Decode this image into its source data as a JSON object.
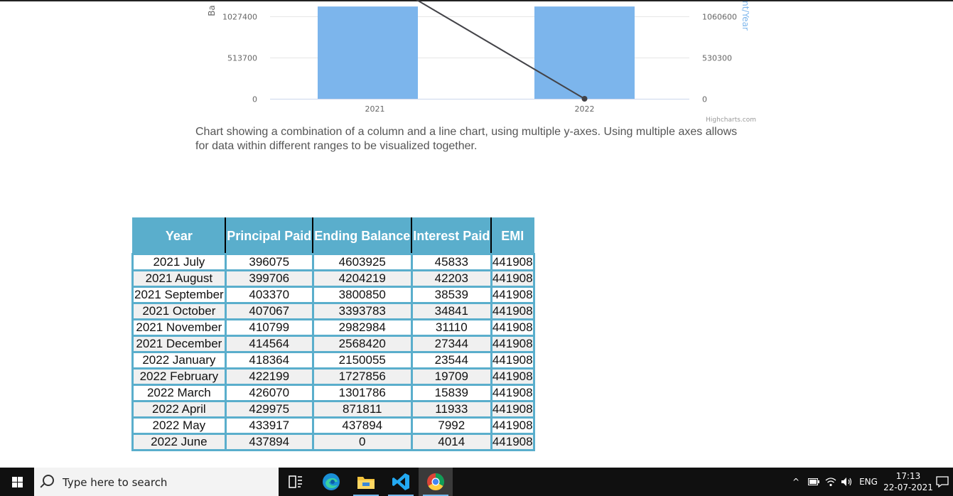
{
  "chart_data": {
    "type": "bar",
    "categories": [
      "2021",
      "2022"
    ],
    "series": [
      {
        "type": "column",
        "values": [
          1150000,
          1150000
        ],
        "axis": "left"
      },
      {
        "type": "line",
        "values": [
          1590000,
          0
        ],
        "axis": "right"
      }
    ],
    "left_axis": {
      "title_fragment": "Ba",
      "ticks": [
        "1027400",
        "513700",
        "0"
      ],
      "tick_values": [
        1027400,
        513700,
        0
      ],
      "range": [
        0,
        1150000
      ]
    },
    "right_axis": {
      "title_fragment": "nt/Year",
      "ticks": [
        "1060600",
        "530300",
        "0"
      ],
      "tick_values": [
        1060600,
        530300,
        0
      ],
      "range": [
        0,
        1187000
      ]
    },
    "credits": "Highcharts.com",
    "colors": {
      "column": "#7cb5ec",
      "line": "#434348",
      "right_title": "#7cb5ec",
      "grid": "#e6e6e6"
    }
  },
  "caption": "Chart showing a combination of a column and a line chart, using multiple y-axes. Using multiple axes allows for data within different ranges to be visualized together.",
  "table": {
    "headers": {
      "year": "Year",
      "principal": "Principal Paid",
      "ending": "Ending Balance",
      "interest": "Interest Paid",
      "emi": "EMI"
    },
    "rows": [
      [
        "2021 July",
        "396075",
        "4603925",
        "45833",
        "441908"
      ],
      [
        "2021 August",
        "399706",
        "4204219",
        "42203",
        "441908"
      ],
      [
        "2021 September",
        "403370",
        "3800850",
        "38539",
        "441908"
      ],
      [
        "2021 October",
        "407067",
        "3393783",
        "34841",
        "441908"
      ],
      [
        "2021 November",
        "410799",
        "2982984",
        "31110",
        "441908"
      ],
      [
        "2021 December",
        "414564",
        "2568420",
        "27344",
        "441908"
      ],
      [
        "2022 January",
        "418364",
        "2150055",
        "23544",
        "441908"
      ],
      [
        "2022 February",
        "422199",
        "1727856",
        "19709",
        "441908"
      ],
      [
        "2022 March",
        "426070",
        "1301786",
        "15839",
        "441908"
      ],
      [
        "2022 April",
        "429975",
        "871811",
        "11933",
        "441908"
      ],
      [
        "2022 May",
        "433917",
        "437894",
        "7992",
        "441908"
      ],
      [
        "2022 June",
        "437894",
        "0",
        "4014",
        "441908"
      ]
    ]
  },
  "taskbar": {
    "search_placeholder": "Type here to search",
    "apps": [
      "task-view",
      "edge",
      "file-explorer",
      "vscode",
      "chrome"
    ],
    "language": "ENG",
    "time": "17:13",
    "date": "22-07-2021",
    "accent": "#76b9ed"
  }
}
